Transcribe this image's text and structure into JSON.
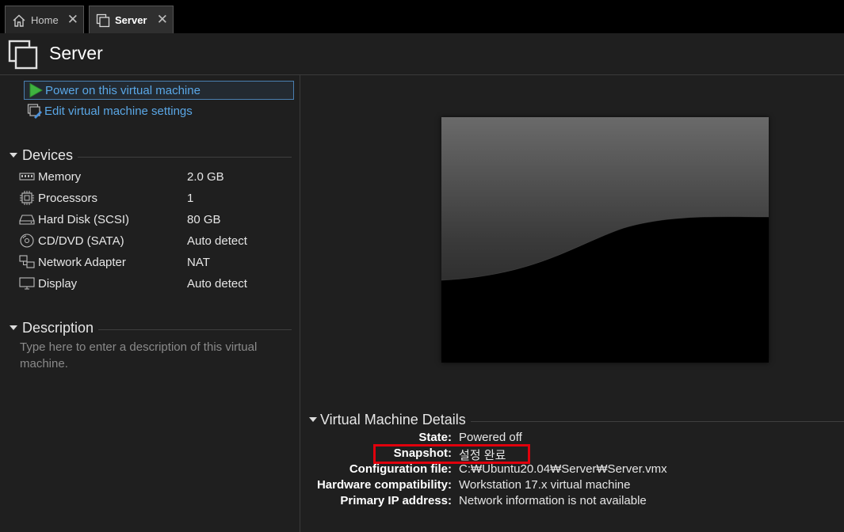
{
  "tabs": [
    {
      "label": "Home",
      "icon": "home-icon",
      "close": "✕"
    },
    {
      "label": "Server",
      "icon": "vm-icon",
      "close": "✕"
    }
  ],
  "header": {
    "title": "Server",
    "icon": "vm-icon"
  },
  "actions": {
    "power_on": "Power on this virtual machine",
    "edit_settings": "Edit virtual machine settings"
  },
  "devices": {
    "heading": "Devices",
    "items": [
      {
        "name": "Memory",
        "value": "2.0 GB",
        "icon": "memory-icon"
      },
      {
        "name": "Processors",
        "value": "1",
        "icon": "processor-icon"
      },
      {
        "name": "Hard Disk (SCSI)",
        "value": "80 GB",
        "icon": "hard-disk-icon"
      },
      {
        "name": "CD/DVD (SATA)",
        "value": "Auto detect",
        "icon": "cd-dvd-icon"
      },
      {
        "name": "Network Adapter",
        "value": "NAT",
        "icon": "network-adapter-icon"
      },
      {
        "name": "Display",
        "value": "Auto detect",
        "icon": "display-icon"
      }
    ]
  },
  "description": {
    "heading": "Description",
    "placeholder": "Type here to enter a description of this virtual machine."
  },
  "details": {
    "heading": "Virtual Machine Details",
    "rows": [
      {
        "label": "State:",
        "value": "Powered off"
      },
      {
        "label": "Snapshot:",
        "value": "설정 완료"
      },
      {
        "label": "Configuration file:",
        "value": "C:₩Ubuntu20.04₩Server₩Server.vmx"
      },
      {
        "label": "Hardware compatibility:",
        "value": "Workstation 17.x virtual machine"
      },
      {
        "label": "Primary IP address:",
        "value": "Network information is not available"
      }
    ]
  },
  "colors": {
    "accent_link": "#5aa7e6",
    "highlight": "#e0000c",
    "power_icon": "#3fb23f"
  }
}
